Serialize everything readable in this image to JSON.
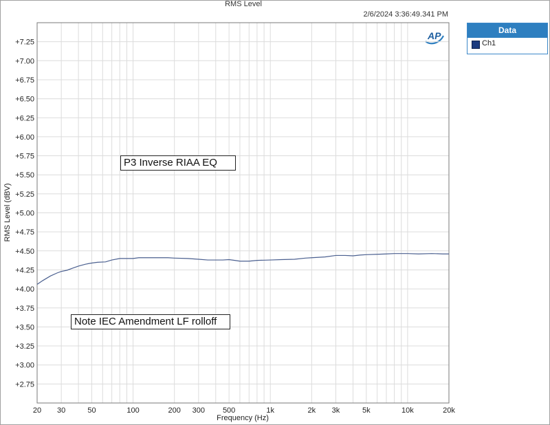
{
  "chart_title": "RMS Level",
  "timestamp": "2/6/2024 3:36:49.341 PM",
  "logo_text": "AP",
  "legend": {
    "header": "Data",
    "entries": [
      {
        "label": "Ch1",
        "color": "#1c3b7e"
      }
    ]
  },
  "annotations": [
    "P3 Inverse RIAA EQ",
    "Note IEC Amendment LF rolloff"
  ],
  "chart_data": {
    "type": "line",
    "title": "RMS Level",
    "xlabel": "Frequency (Hz)",
    "ylabel": "RMS Level (dBV)",
    "xscale": "log",
    "xlim": [
      20,
      20000
    ],
    "ylim": [
      2.5,
      7.5
    ],
    "grid": true,
    "legend_position": "right",
    "x_ticks": [
      {
        "value": 20,
        "label": "20"
      },
      {
        "value": 30,
        "label": "30"
      },
      {
        "value": 50,
        "label": "50"
      },
      {
        "value": 100,
        "label": "100"
      },
      {
        "value": 200,
        "label": "200"
      },
      {
        "value": 300,
        "label": "300"
      },
      {
        "value": 500,
        "label": "500"
      },
      {
        "value": 1000,
        "label": "1k"
      },
      {
        "value": 2000,
        "label": "2k"
      },
      {
        "value": 3000,
        "label": "3k"
      },
      {
        "value": 5000,
        "label": "5k"
      },
      {
        "value": 10000,
        "label": "10k"
      },
      {
        "value": 20000,
        "label": "20k"
      }
    ],
    "y_ticks": [
      {
        "value": 7.25,
        "label": "+7.25"
      },
      {
        "value": 7.0,
        "label": "+7.00"
      },
      {
        "value": 6.75,
        "label": "+6.75"
      },
      {
        "value": 6.5,
        "label": "+6.50"
      },
      {
        "value": 6.25,
        "label": "+6.25"
      },
      {
        "value": 6.0,
        "label": "+6.00"
      },
      {
        "value": 5.75,
        "label": "+5.75"
      },
      {
        "value": 5.5,
        "label": "+5.50"
      },
      {
        "value": 5.25,
        "label": "+5.25"
      },
      {
        "value": 5.0,
        "label": "+5.00"
      },
      {
        "value": 4.75,
        "label": "+4.75"
      },
      {
        "value": 4.5,
        "label": "+4.50"
      },
      {
        "value": 4.25,
        "label": "+4.25"
      },
      {
        "value": 4.0,
        "label": "+4.00"
      },
      {
        "value": 3.75,
        "label": "+3.75"
      },
      {
        "value": 3.5,
        "label": "+3.50"
      },
      {
        "value": 3.25,
        "label": "+3.25"
      },
      {
        "value": 3.0,
        "label": "+3.00"
      },
      {
        "value": 2.75,
        "label": "+2.75"
      }
    ],
    "series": [
      {
        "name": "Ch1",
        "color": "#4a5f8f",
        "points": [
          [
            20,
            4.06
          ],
          [
            22,
            4.11
          ],
          [
            25,
            4.17
          ],
          [
            28,
            4.21
          ],
          [
            30,
            4.23
          ],
          [
            33,
            4.245
          ],
          [
            36,
            4.27
          ],
          [
            40,
            4.3
          ],
          [
            45,
            4.325
          ],
          [
            50,
            4.34
          ],
          [
            55,
            4.35
          ],
          [
            63,
            4.355
          ],
          [
            70,
            4.38
          ],
          [
            80,
            4.4
          ],
          [
            90,
            4.4
          ],
          [
            100,
            4.4
          ],
          [
            110,
            4.41
          ],
          [
            125,
            4.41
          ],
          [
            150,
            4.41
          ],
          [
            180,
            4.41
          ],
          [
            200,
            4.405
          ],
          [
            250,
            4.4
          ],
          [
            300,
            4.39
          ],
          [
            350,
            4.38
          ],
          [
            400,
            4.38
          ],
          [
            450,
            4.38
          ],
          [
            500,
            4.385
          ],
          [
            550,
            4.375
          ],
          [
            600,
            4.365
          ],
          [
            700,
            4.365
          ],
          [
            800,
            4.375
          ],
          [
            1000,
            4.38
          ],
          [
            1200,
            4.385
          ],
          [
            1500,
            4.39
          ],
          [
            1800,
            4.405
          ],
          [
            2000,
            4.41
          ],
          [
            2500,
            4.42
          ],
          [
            3000,
            4.44
          ],
          [
            3500,
            4.44
          ],
          [
            4000,
            4.435
          ],
          [
            4500,
            4.445
          ],
          [
            5000,
            4.45
          ],
          [
            6000,
            4.455
          ],
          [
            7000,
            4.46
          ],
          [
            8000,
            4.465
          ],
          [
            10000,
            4.465
          ],
          [
            12000,
            4.46
          ],
          [
            15000,
            4.465
          ],
          [
            18000,
            4.46
          ],
          [
            20000,
            4.46
          ]
        ]
      }
    ]
  }
}
